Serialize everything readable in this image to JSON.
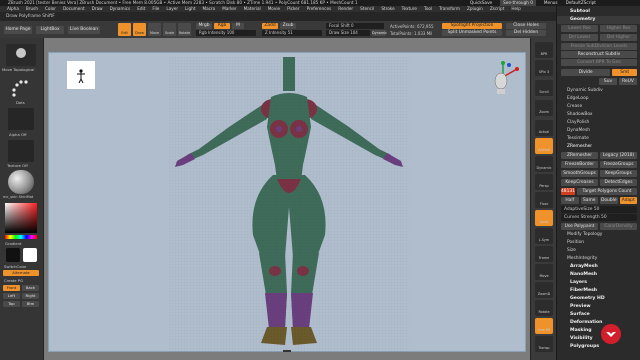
{
  "titlebar": {
    "text": "ZBrush 2021 [tester Beniez Vera]   ZBrush Document   • Free Mem 8.005GB • Active Mem 2283 • Scratch Disk 80 • ZTime 1.941 • PolyCount 681.185 KP • MeshCount 1",
    "quicksave": "QuickSave",
    "seethrough": "See-through 0",
    "menus": "Menus",
    "defaultzscript": "DefaultZScript"
  },
  "menubar": [
    "Alpha",
    "Brush",
    "Color",
    "Document",
    "Draw",
    "Dynamics",
    "Edit",
    "File",
    "Layer",
    "Light",
    "Macro",
    "Marker",
    "Material",
    "Movie",
    "Picker",
    "Preferences",
    "Render",
    "Stencil",
    "Stroke",
    "Texture",
    "Tool",
    "Transform",
    "Zplugin",
    "Zscript",
    "Help"
  ],
  "subbar": {
    "label": "Draw Polyframe ShiftF"
  },
  "left": {
    "homepage": "Home Page",
    "lightbox": "LightBox",
    "livebool": "Live Boolean",
    "brush_label": "Move Topological",
    "stroke_label": "Dots",
    "alpha_label": "Alpha Off",
    "texture_label": "Texture Off",
    "material_label": "mc_skin ShinMat",
    "gradient": "Gradient",
    "switchcolor": "SwitchColor",
    "alternate": "Alternate",
    "create_label": "Create PG",
    "views": [
      "Front",
      "Back",
      "Left",
      "Right",
      "Top",
      "Btm"
    ]
  },
  "toolbar": {
    "edit": "Edit",
    "draw": "Draw",
    "move": "Move",
    "scale": "Scale",
    "rotate": "Rotate",
    "mrgb": "Mrgb",
    "rgb": "Rgb",
    "m": "M",
    "rgb_intensity": "Rgb Intensity 100",
    "zadd": "Zadd",
    "zsub": "Zsub",
    "zintensity": "Z Intensity 51",
    "focal": "Focal Shift 0",
    "drawsize": "Draw Size 104",
    "dynamic": "Dynamic",
    "activepoints": "ActivePoints: 672,955",
    "totalpoints": "TotalPoints: 1.033 Mil",
    "spotlight": "Spotlight Projection",
    "uvsplit": "Split Unmasked Points",
    "closeholes": "Close Holes",
    "delhidden": "Del Hidden"
  },
  "vshelf": [
    "BPR",
    "SPix 3",
    "Scroll",
    "Zoom",
    "Actual",
    "AAHalf",
    "Dynamic",
    "Persp",
    "Floor",
    "Local",
    "L.Sym",
    "Frame",
    "Move",
    "ZoomD",
    "Rotate",
    "Line Fill",
    "Transp",
    "Ghost",
    "Solo",
    "Xpose"
  ],
  "right": {
    "subtool": "Subtool",
    "geometry": "Geometry",
    "lower_res": "Lower Res",
    "higher_res": "Higher Res",
    "del_lower": "Del Lower",
    "del_higher": "Del Higher",
    "freeze": "Freeze SubDivision Levels",
    "reconstruct": "Reconstruct Subdiv",
    "convert_bpr": "Convert BPR To Geo",
    "divide": "Divide",
    "smt": "Smt",
    "suv": "Suv",
    "reuv": "ReUV",
    "dynamic_subdiv": "Dynamic Subdiv",
    "edgeloop": "EdgeLoop",
    "crease": "Crease",
    "shadowbox": "ShadowBox",
    "claypolish": "ClayPolish",
    "dynamesh": "DynaMesh",
    "tessimate": "Tessimate",
    "zremesher": "ZRemesher",
    "zremesher_btn": "ZRemesher",
    "legacy": "Legacy (2018)",
    "freezeborder": "FreezeBorder",
    "freezegroups": "FreezeGroups",
    "smoothgroups": "SmoothGroups",
    "keepgroups": "KeepGroups",
    "keepcreases": "KeepCreases",
    "detectedges": "DetectEdges",
    "target_value": "48131",
    "target_label": "Target Polygons Count",
    "half": "Half",
    "same": "Same",
    "double": "Double",
    "adapt": "Adapt",
    "adaptivesize": "AdaptiveSize 50",
    "curvesstrength": "Curves Strength 50",
    "usepolypaint": "Use Polypaint",
    "colordensity": "ColorDensity",
    "modifytopology": "Modify Topology",
    "position": "Position",
    "size": "Size",
    "meshintegrity": "MeshIntegrity",
    "sections": [
      "ArrayMesh",
      "NanoMesh",
      "Layers",
      "FiberMesh",
      "Geometry HD",
      "Preview",
      "Surface",
      "Deformation",
      "Masking",
      "Visibility",
      "Polygroups"
    ]
  },
  "colors": {
    "accent": "#f0922b",
    "canvas": "#b0bdcd",
    "body": "#3f6c5a",
    "purple": "#6a3f7e",
    "maroon": "#7a3345"
  }
}
